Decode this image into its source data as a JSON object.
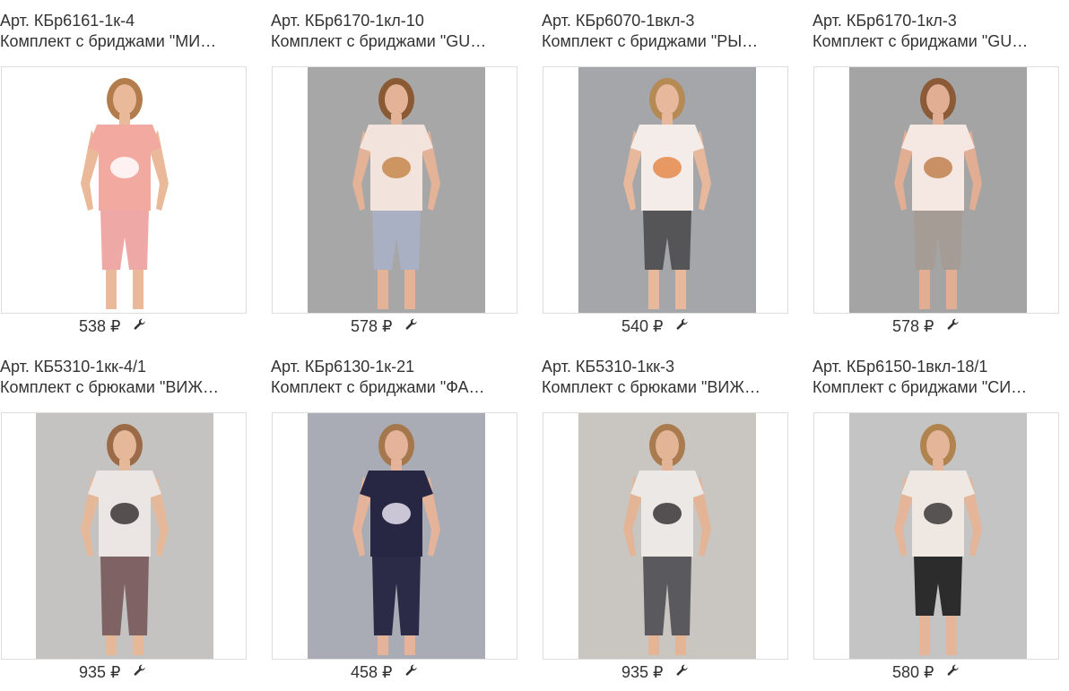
{
  "products": [
    {
      "article": "Арт. КБр6161-1к-4",
      "name": "Комплект с бриджами \"МИ…",
      "price": "538 ₽",
      "colors": {
        "bg": "#ffffff",
        "top": "#f2a9a0",
        "bottom": "#eea9a6",
        "skin": "#e9b99a",
        "hair": "#b27c4c",
        "print": "#ffffff"
      },
      "icon": "wrench-icon"
    },
    {
      "article": "Арт. КБр6170-1кл-10",
      "name": "Комплект с бриджами \"GU…",
      "price": "578 ₽",
      "colors": {
        "bg": "#a7a7a7",
        "top": "#f3e3dd",
        "bottom": "#aab0c4",
        "skin": "#e4b297",
        "hair": "#8a5a35",
        "print": "#c4874b"
      },
      "icon": "wrench-icon"
    },
    {
      "article": "Арт. КБр6070-1вкл-3",
      "name": "Комплект с бриджами \"РЫ…",
      "price": "540 ₽",
      "colors": {
        "bg": "#a5a6a9",
        "top": "#f4ece8",
        "bottom": "#555557",
        "skin": "#e7b89c",
        "hair": "#b68a55",
        "print": "#e5894a"
      },
      "icon": "wrench-icon"
    },
    {
      "article": "Арт. КБр6170-1кл-3",
      "name": "Комплект с бриджами \"GU…",
      "price": "578 ₽",
      "colors": {
        "bg": "#a4a4a4",
        "top": "#f5e8e3",
        "bottom": "#a49c95",
        "skin": "#e2ae93",
        "hair": "#8b5b38",
        "print": "#c18050"
      },
      "icon": "wrench-icon"
    },
    {
      "article": "Арт. КБ5310-1кк-4/1",
      "name": "Комплект с брюками \"ВИЖ…",
      "price": "935 ₽",
      "colors": {
        "bg": "#c4c3c2",
        "top": "#ebe6e4",
        "bottom": "#7e6264",
        "skin": "#e5b899",
        "hair": "#9b6b47",
        "print": "#3c3436"
      },
      "icon": "wrench-icon"
    },
    {
      "article": "Арт. КБр6130-1к-21",
      "name": "Комплект с бриджами \"ФА…",
      "price": "458 ₽",
      "colors": {
        "bg": "#a9acb5",
        "top": "#272744",
        "bottom": "#2b2b47",
        "skin": "#e4b39a",
        "hair": "#a5774c",
        "print": "#e8e3ef"
      },
      "icon": "wrench-icon"
    },
    {
      "article": "Арт. КБ5310-1кк-3",
      "name": "Комплект с брюками \"ВИЖ…",
      "price": "935 ₽",
      "colors": {
        "bg": "#c9c5c1",
        "top": "#ece8e5",
        "bottom": "#5a5a5e",
        "skin": "#e3b596",
        "hair": "#aa7b4e",
        "print": "#3a3436"
      },
      "icon": "wrench-icon"
    },
    {
      "article": "Арт. КБр6150-1вкл-18/1",
      "name": "Комплект с бриджами \"СИ…",
      "price": "580 ₽",
      "colors": {
        "bg": "#c4c4c4",
        "top": "#eee7e2",
        "bottom": "#2c2c2c",
        "skin": "#e4b598",
        "hair": "#b0834f",
        "print": "#3b3838"
      },
      "icon": "wrench-icon"
    }
  ]
}
